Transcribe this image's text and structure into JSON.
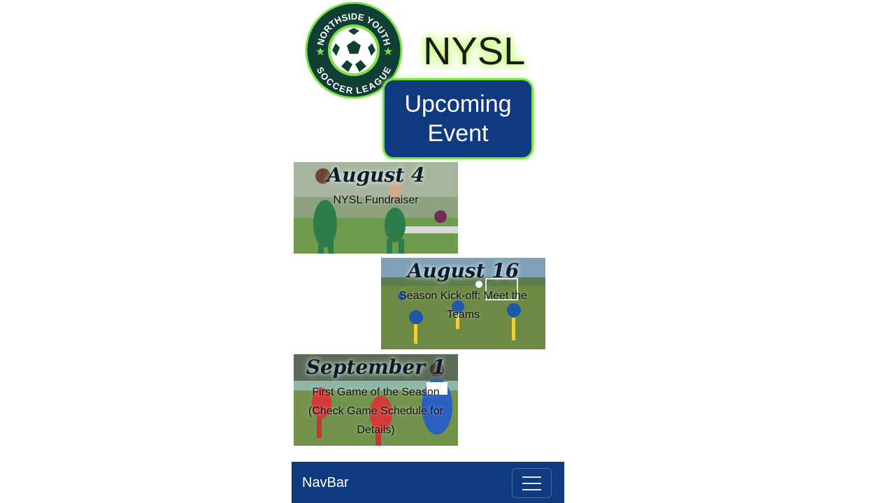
{
  "header": {
    "logo": {
      "top_text": "NORTHSIDE YOUTH",
      "bottom_text": "SOCCER LEAGUE",
      "icon": "soccer-ball-icon"
    },
    "brand": "NYSL",
    "section_button": [
      "Upcoming",
      "Event"
    ]
  },
  "events": [
    {
      "date": "August 4",
      "description": "NYSL Fundraiser"
    },
    {
      "date": "August 16",
      "description": "Season Kick-off: Meet the Teams"
    },
    {
      "date": "September 1",
      "description": "First Game of the Season (Check Game Schedule for Details)"
    }
  ],
  "navbar": {
    "brand": "NavBar",
    "toggle_icon": "hamburger-menu-icon"
  },
  "colors": {
    "primary": "#0f3a80",
    "accent_green": "#7be24a",
    "glow": "#b6ff5c"
  }
}
